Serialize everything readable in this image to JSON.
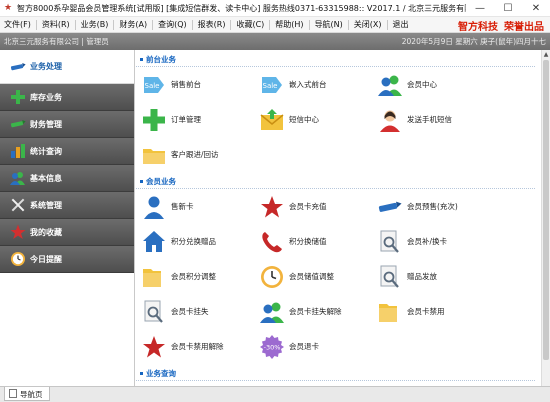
{
  "titlebar": {
    "title": "智方8000系孕婴品会员管理系统[试用版] [集成短信群发、读卡中心] 服务热线0371-63315988:: V2017.1 / 北京三元服务有限公司",
    "minimize": "—",
    "maximize": "☐",
    "close": "✕"
  },
  "menu": {
    "items": [
      "文件(F)",
      "资料(R)",
      "业务(B)",
      "财务(A)",
      "查询(Q)",
      "报表(R)",
      "收藏(C)",
      "帮助(H)",
      "导航(N)",
      "关闭(X)",
      "退出"
    ],
    "brand_left": "智方科技",
    "brand_right": "荣誉出品"
  },
  "status": {
    "left": "北京三元服务有限公司 | 管理员",
    "right": "2020年5月9日 星期六 庚子(鼠年)四月十七"
  },
  "sidebar": {
    "items": [
      {
        "label": "业务处理",
        "icon": "pen-icon",
        "color": "#2a6fc0"
      },
      {
        "label": "库存业务",
        "icon": "plus-icon",
        "color": "#2e9d3a"
      },
      {
        "label": "财务管理",
        "icon": "pen-icon",
        "color": "#2e9d3a"
      },
      {
        "label": "统计查询",
        "icon": "bar-chart-icon",
        "color": "#e8a020"
      },
      {
        "label": "基本信息",
        "icon": "users-icon",
        "color": "#2a6fc0"
      },
      {
        "label": "系统管理",
        "icon": "tools-icon",
        "color": "#cfcfcf"
      },
      {
        "label": "我的收藏",
        "icon": "star-icon",
        "color": "#c0392b"
      },
      {
        "label": "今日提醒",
        "icon": "clock-icon",
        "color": "#e8a020"
      }
    ]
  },
  "sections": [
    {
      "title": "前台业务",
      "tiles": [
        {
          "label": "销售前台",
          "icon": "sale-tag-icon"
        },
        {
          "label": "嵌入式前台",
          "icon": "sale-tag-icon"
        },
        {
          "label": "会员中心",
          "icon": "users-icon"
        },
        {
          "label": "订单管理",
          "icon": "plus-icon"
        },
        {
          "label": "短信中心",
          "icon": "envelope-icon"
        },
        {
          "label": "发送手机短信",
          "icon": "person-icon"
        },
        {
          "label": "客户跟进/回访",
          "icon": "folder-icon"
        }
      ]
    },
    {
      "title": "会员业务",
      "tiles": [
        {
          "label": "售新卡",
          "icon": "person-icon"
        },
        {
          "label": "会员卡充值",
          "icon": "star-icon"
        },
        {
          "label": "会员预售(充次)",
          "icon": "pen-icon"
        },
        {
          "label": "积分兑换赠品",
          "icon": "home-icon"
        },
        {
          "label": "积分换储值",
          "icon": "phone-icon"
        },
        {
          "label": "会员补/换卡",
          "icon": "search-doc-icon"
        },
        {
          "label": "会员积分调整",
          "icon": "folder-icon"
        },
        {
          "label": "会员储值调整",
          "icon": "clock-icon"
        },
        {
          "label": "赠品发放",
          "icon": "search-doc-icon"
        },
        {
          "label": "会员卡挂失",
          "icon": "search-doc-icon"
        },
        {
          "label": "会员卡挂失解除",
          "icon": "users-icon"
        },
        {
          "label": "会员卡禁用",
          "icon": "folder-icon"
        },
        {
          "label": "会员卡禁用解除",
          "icon": "star-icon"
        },
        {
          "label": "会员退卡",
          "icon": "discount-icon"
        }
      ]
    },
    {
      "title": "业务查询",
      "tiles": []
    }
  ],
  "discount_text": "-30%",
  "sale_text": "Sale",
  "tab": {
    "label": "导航页"
  }
}
